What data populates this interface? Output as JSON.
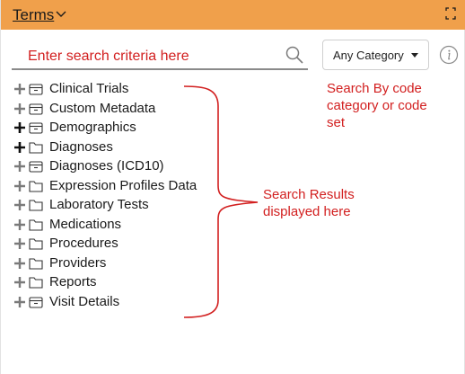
{
  "header": {
    "title": "Terms",
    "chevron_icon": "chevron-down-icon",
    "expand_icon": "expand-icon",
    "color": "#f0a04b"
  },
  "search": {
    "placeholder": "Enter search criteria here",
    "icon": "search-icon"
  },
  "category": {
    "selected": "Any Category",
    "icon": "caret-down-icon"
  },
  "info": {
    "icon": "info-icon"
  },
  "tree": {
    "items": [
      {
        "label": "Clinical Trials",
        "icon": "folder-archive-icon"
      },
      {
        "label": "Custom Metadata",
        "icon": "folder-archive-icon"
      },
      {
        "label": "Demographics",
        "icon": "folder-archive-icon"
      },
      {
        "label": "Diagnoses",
        "icon": "folder-icon"
      },
      {
        "label": "Diagnoses (ICD10)",
        "icon": "folder-archive-icon"
      },
      {
        "label": "Expression Profiles Data",
        "icon": "folder-icon"
      },
      {
        "label": "Laboratory Tests",
        "icon": "folder-icon"
      },
      {
        "label": "Medications",
        "icon": "folder-icon"
      },
      {
        "label": "Procedures",
        "icon": "folder-icon"
      },
      {
        "label": "Providers",
        "icon": "folder-icon"
      },
      {
        "label": "Reports",
        "icon": "folder-icon"
      },
      {
        "label": "Visit Details",
        "icon": "folder-archive-icon"
      }
    ]
  },
  "annotations": {
    "top": [
      "Search By code",
      "category or code",
      "set"
    ],
    "middle": [
      "Search Results",
      "displayed here"
    ],
    "color": "#d21f1f"
  }
}
